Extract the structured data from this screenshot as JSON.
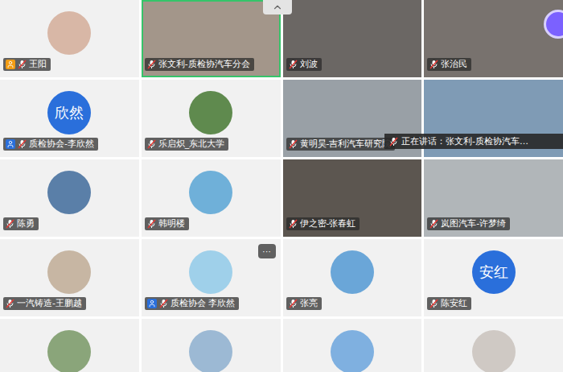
{
  "tiles": [
    {
      "name": "王阳",
      "kind": "photo-avatar",
      "avatarText": "",
      "color": "#d8b7a6",
      "role": "host",
      "speaking": false,
      "muted": true,
      "menu": ""
    },
    {
      "name": "张文利-质检协汽车分会",
      "kind": "video",
      "avatarText": "",
      "color": "#a3968a",
      "role": "member",
      "speaking": true,
      "muted": true,
      "menu": ""
    },
    {
      "name": "刘波",
      "kind": "video",
      "avatarText": "",
      "color": "#6b6764",
      "role": "member",
      "speaking": false,
      "muted": true,
      "menu": ""
    },
    {
      "name": "张治民",
      "kind": "video",
      "avatarText": "",
      "color": "#78726e",
      "role": "member",
      "speaking": false,
      "muted": true,
      "menu": ""
    },
    {
      "name": "质检协会-李欣然",
      "kind": "text-avatar",
      "avatarText": "欣然",
      "color": "#2a6fdb",
      "role": "cohost",
      "speaking": false,
      "muted": true,
      "menu": ""
    },
    {
      "name": "乐启炽_东北大学",
      "kind": "photo-avatar",
      "avatarText": "",
      "color": "#5f8a4e",
      "role": "member",
      "speaking": false,
      "muted": true,
      "menu": ""
    },
    {
      "name": "黄明昊-吉利汽车研究院",
      "kind": "video",
      "avatarText": "",
      "color": "#99a0a6",
      "role": "member",
      "speaking": false,
      "muted": true,
      "menu": ""
    },
    {
      "name": "",
      "kind": "video",
      "avatarText": "",
      "color": "#7f9bb5",
      "role": "member",
      "speaking": false,
      "muted": true,
      "menu": ""
    },
    {
      "name": "陈勇",
      "kind": "photo-avatar",
      "avatarText": "",
      "color": "#5a7fa8",
      "role": "member",
      "speaking": false,
      "muted": true,
      "menu": ""
    },
    {
      "name": "韩明楼",
      "kind": "photo-avatar",
      "avatarText": "",
      "color": "#6fb0d9",
      "role": "member",
      "speaking": false,
      "muted": true,
      "menu": ""
    },
    {
      "name": "伊之密-张春虹",
      "kind": "video",
      "avatarText": "",
      "color": "#5c5650",
      "role": "member",
      "speaking": false,
      "muted": true,
      "menu": ""
    },
    {
      "name": "岚图汽车-许梦绮",
      "kind": "video",
      "avatarText": "",
      "color": "#b1b6b9",
      "role": "member",
      "speaking": false,
      "muted": true,
      "menu": ""
    },
    {
      "name": "一汽铸造-王鹏越",
      "kind": "photo-avatar",
      "avatarText": "",
      "color": "#c7b6a3",
      "role": "member",
      "speaking": false,
      "muted": true,
      "menu": ""
    },
    {
      "name": "质检协会 李欣然",
      "kind": "photo-avatar",
      "avatarText": "",
      "color": "#9fd0ea",
      "role": "cohost",
      "speaking": false,
      "muted": true,
      "menu": "···"
    },
    {
      "name": "张亮",
      "kind": "photo-avatar",
      "avatarText": "",
      "color": "#6aa6d8",
      "role": "member",
      "speaking": false,
      "muted": true,
      "menu": ""
    },
    {
      "name": "陈安红",
      "kind": "text-avatar",
      "avatarText": "安红",
      "color": "#2a6fdb",
      "role": "member",
      "speaking": false,
      "muted": true,
      "menu": ""
    },
    {
      "name": "",
      "kind": "photo-avatar",
      "avatarText": "",
      "color": "#8aa57a",
      "role": "member",
      "speaking": false,
      "muted": false,
      "menu": ""
    },
    {
      "name": "",
      "kind": "photo-avatar",
      "avatarText": "",
      "color": "#9cb9d4",
      "role": "member",
      "speaking": false,
      "muted": false,
      "menu": ""
    },
    {
      "name": "",
      "kind": "photo-avatar",
      "avatarText": "",
      "color": "#7fb0e0",
      "role": "member",
      "speaking": false,
      "muted": false,
      "menu": ""
    },
    {
      "name": "",
      "kind": "photo-avatar",
      "avatarText": "",
      "color": "#cfc9c4",
      "role": "member",
      "speaking": false,
      "muted": false,
      "menu": ""
    }
  ],
  "tooltip": {
    "text": "正在讲话：张文利-质检协汽车…"
  }
}
